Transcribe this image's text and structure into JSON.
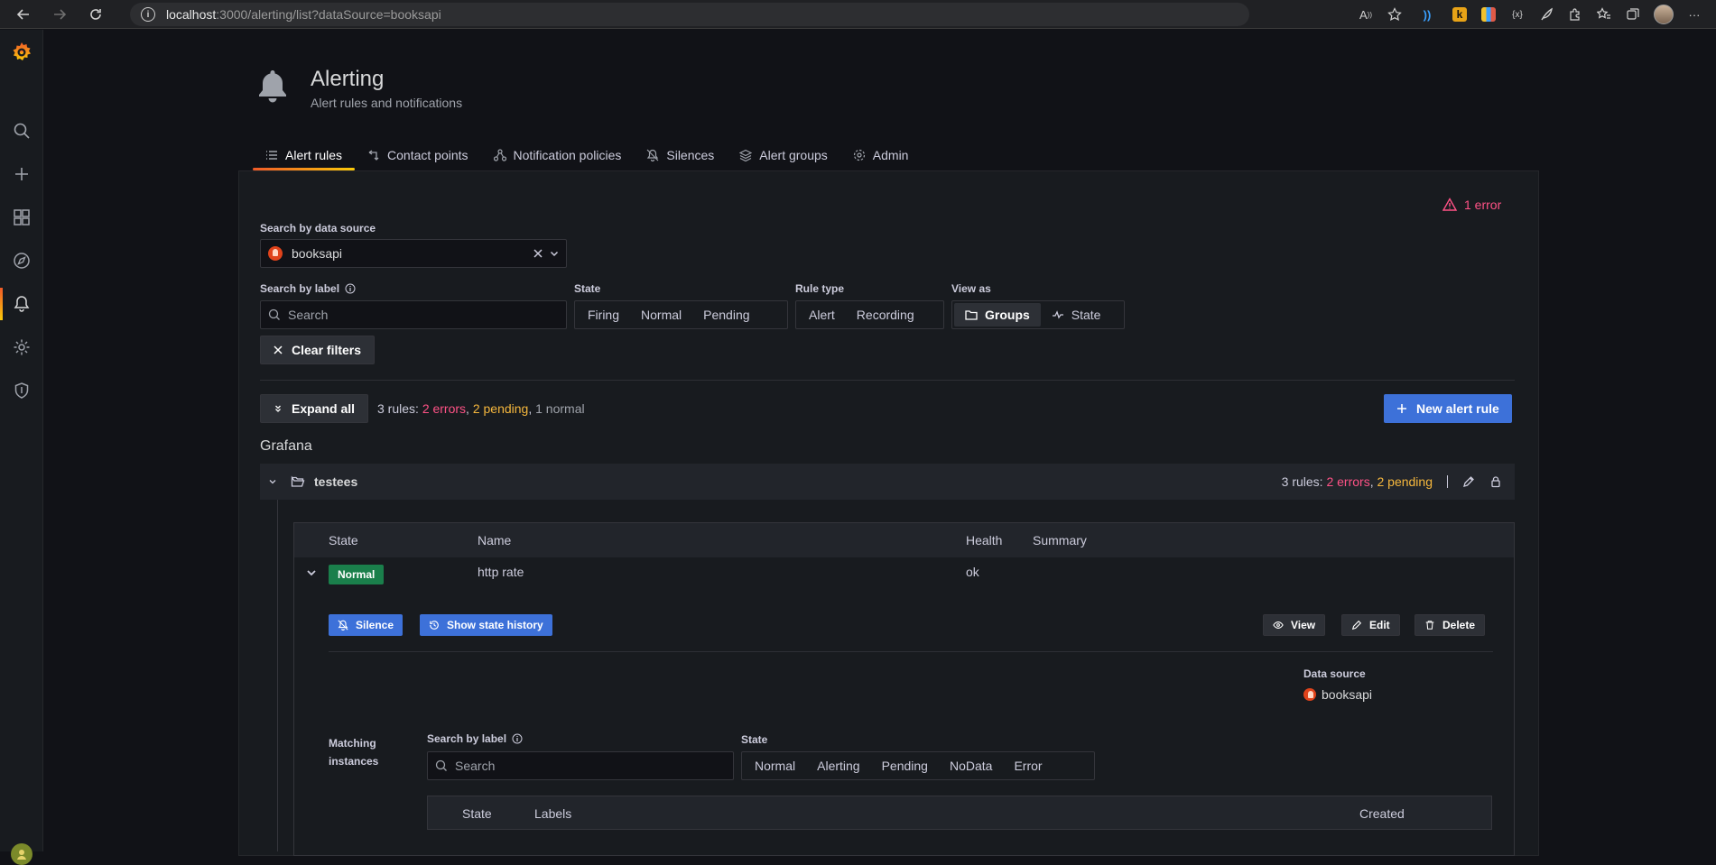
{
  "browser": {
    "url_host": "localhost",
    "url_path": ":3000/alerting/list?dataSource=booksapi"
  },
  "sidemenu": {
    "items": [
      {
        "name": "grafana-logo"
      },
      {
        "name": "search-icon"
      },
      {
        "name": "plus-icon"
      },
      {
        "name": "dashboards-icon"
      },
      {
        "name": "explore-compass-icon"
      },
      {
        "name": "alerting-bell-icon"
      },
      {
        "name": "gear-icon"
      },
      {
        "name": "shield-icon"
      }
    ]
  },
  "header": {
    "title": "Alerting",
    "subtitle": "Alert rules and notifications"
  },
  "tabs": [
    {
      "label": "Alert rules",
      "icon": "list-icon",
      "active": true
    },
    {
      "label": "Contact points",
      "icon": "contact-icon"
    },
    {
      "label": "Notification policies",
      "icon": "sitemap-icon"
    },
    {
      "label": "Silences",
      "icon": "bell-slash-icon"
    },
    {
      "label": "Alert groups",
      "icon": "layers-icon"
    },
    {
      "label": "Admin",
      "icon": "cog-icon"
    }
  ],
  "errors": {
    "text": "1 error",
    "color": "#ff5286"
  },
  "filters": {
    "datasource_label": "Search by data source",
    "datasource_value": "booksapi",
    "label_search_label": "Search by label",
    "label_search_placeholder": "Search",
    "state_label": "State",
    "state_options": [
      "Firing",
      "Normal",
      "Pending"
    ],
    "rule_type_label": "Rule type",
    "rule_type_options": [
      "Alert",
      "Recording"
    ],
    "view_as_label": "View as",
    "view_as_options": [
      "Groups",
      "State"
    ],
    "view_as_selected": "Groups",
    "clear_filters": "Clear filters"
  },
  "toolbar": {
    "expand_all": "Expand all",
    "summary_prefix": "3 rules: ",
    "summary_errors": "2 errors",
    "summary_sep1": ", ",
    "summary_pending": "2 pending",
    "summary_sep2": ", ",
    "summary_normal": "1 normal",
    "new_alert_rule": "New alert rule"
  },
  "section": {
    "title": "Grafana"
  },
  "group": {
    "name": "testees",
    "summary_prefix": "3 rules: ",
    "summary_errors": "2 errors",
    "summary_sep": ", ",
    "summary_pending": "2 pending"
  },
  "rules_table": {
    "columns": [
      "State",
      "Name",
      "Health",
      "Summary"
    ],
    "rows": [
      {
        "state": "Normal",
        "name": "http rate",
        "health": "ok",
        "summary": ""
      }
    ]
  },
  "rule_details": {
    "silence": "Silence",
    "show_state_history": "Show state history",
    "view": "View",
    "edit": "Edit",
    "delete": "Delete",
    "datasource_key": "Data source",
    "datasource_value": "booksapi",
    "matching_instances": "Matching instances",
    "label_search_label": "Search by label",
    "label_search_placeholder": "Search",
    "state_label": "State",
    "state_options": [
      "Normal",
      "Alerting",
      "Pending",
      "NoData",
      "Error"
    ],
    "instances_columns": [
      "State",
      "Labels",
      "Created"
    ]
  },
  "colors": {
    "accent_blue": "#3d71d9",
    "error_pink": "#ff5286",
    "pending_orange": "#ff9830",
    "normal_green": "#1a7f4b"
  }
}
